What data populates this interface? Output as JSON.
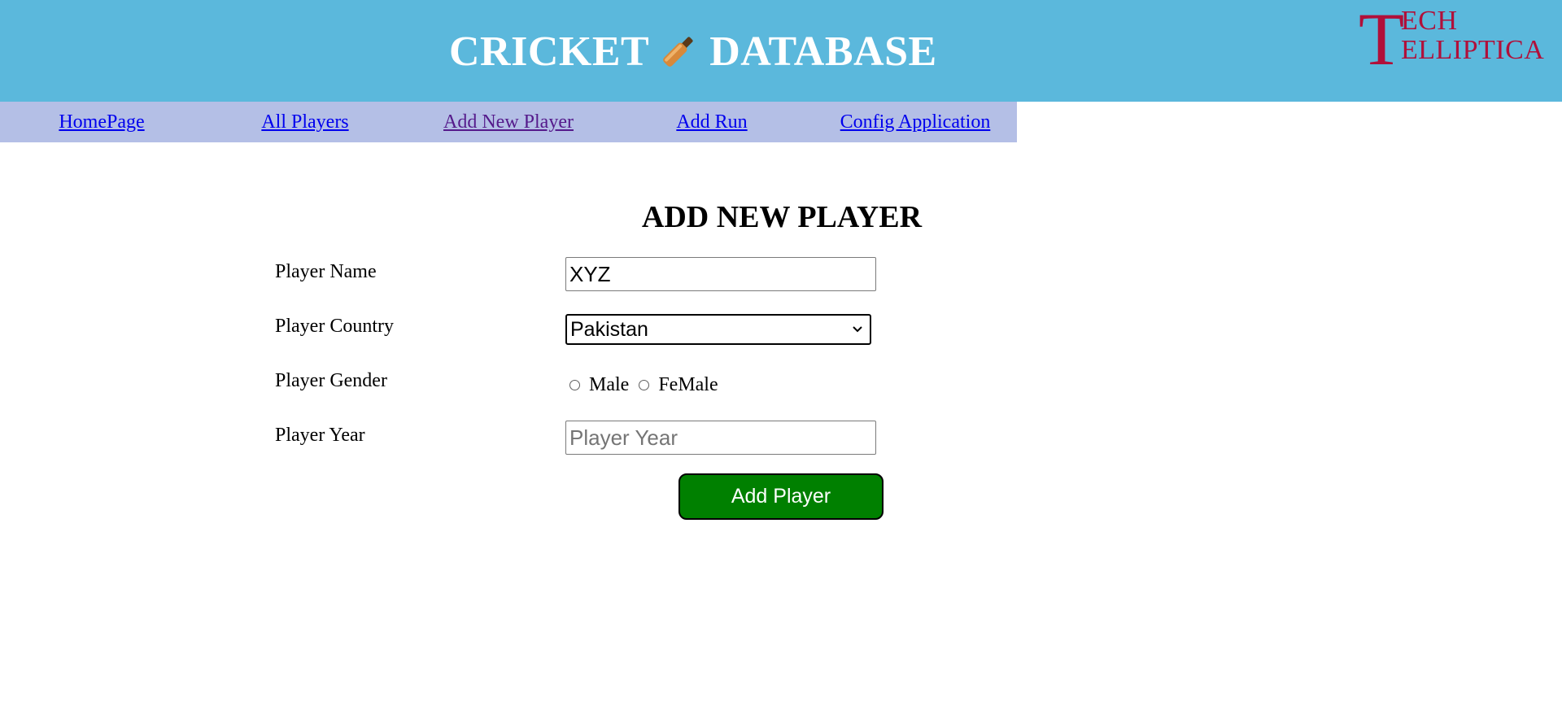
{
  "header": {
    "title_left": "CRICKET",
    "title_icon": "cricket-bat-icon",
    "title_right": "DATABASE",
    "logo": {
      "big_letter": "T",
      "row1": "ECH",
      "row2": "ELLIPTICA",
      "color": "#b0103a"
    },
    "background_color": "#5bb8dc"
  },
  "nav": {
    "background_color": "#b4bfe6",
    "items": [
      {
        "label": "HomePage"
      },
      {
        "label": "All Players"
      },
      {
        "label": "Add New Player"
      },
      {
        "label": "Add Run"
      },
      {
        "label": "Config Application"
      }
    ]
  },
  "form": {
    "title": "ADD NEW PLAYER",
    "name_label": "Player Name",
    "name_value": "XYZ",
    "country_label": "Player Country",
    "country_selected": "Pakistan",
    "gender_label": "Player Gender",
    "gender_options": [
      "Male",
      "FeMale"
    ],
    "year_label": "Player Year",
    "year_placeholder": "Player Year",
    "submit_label": "Add Player",
    "submit_color": "#008000"
  }
}
